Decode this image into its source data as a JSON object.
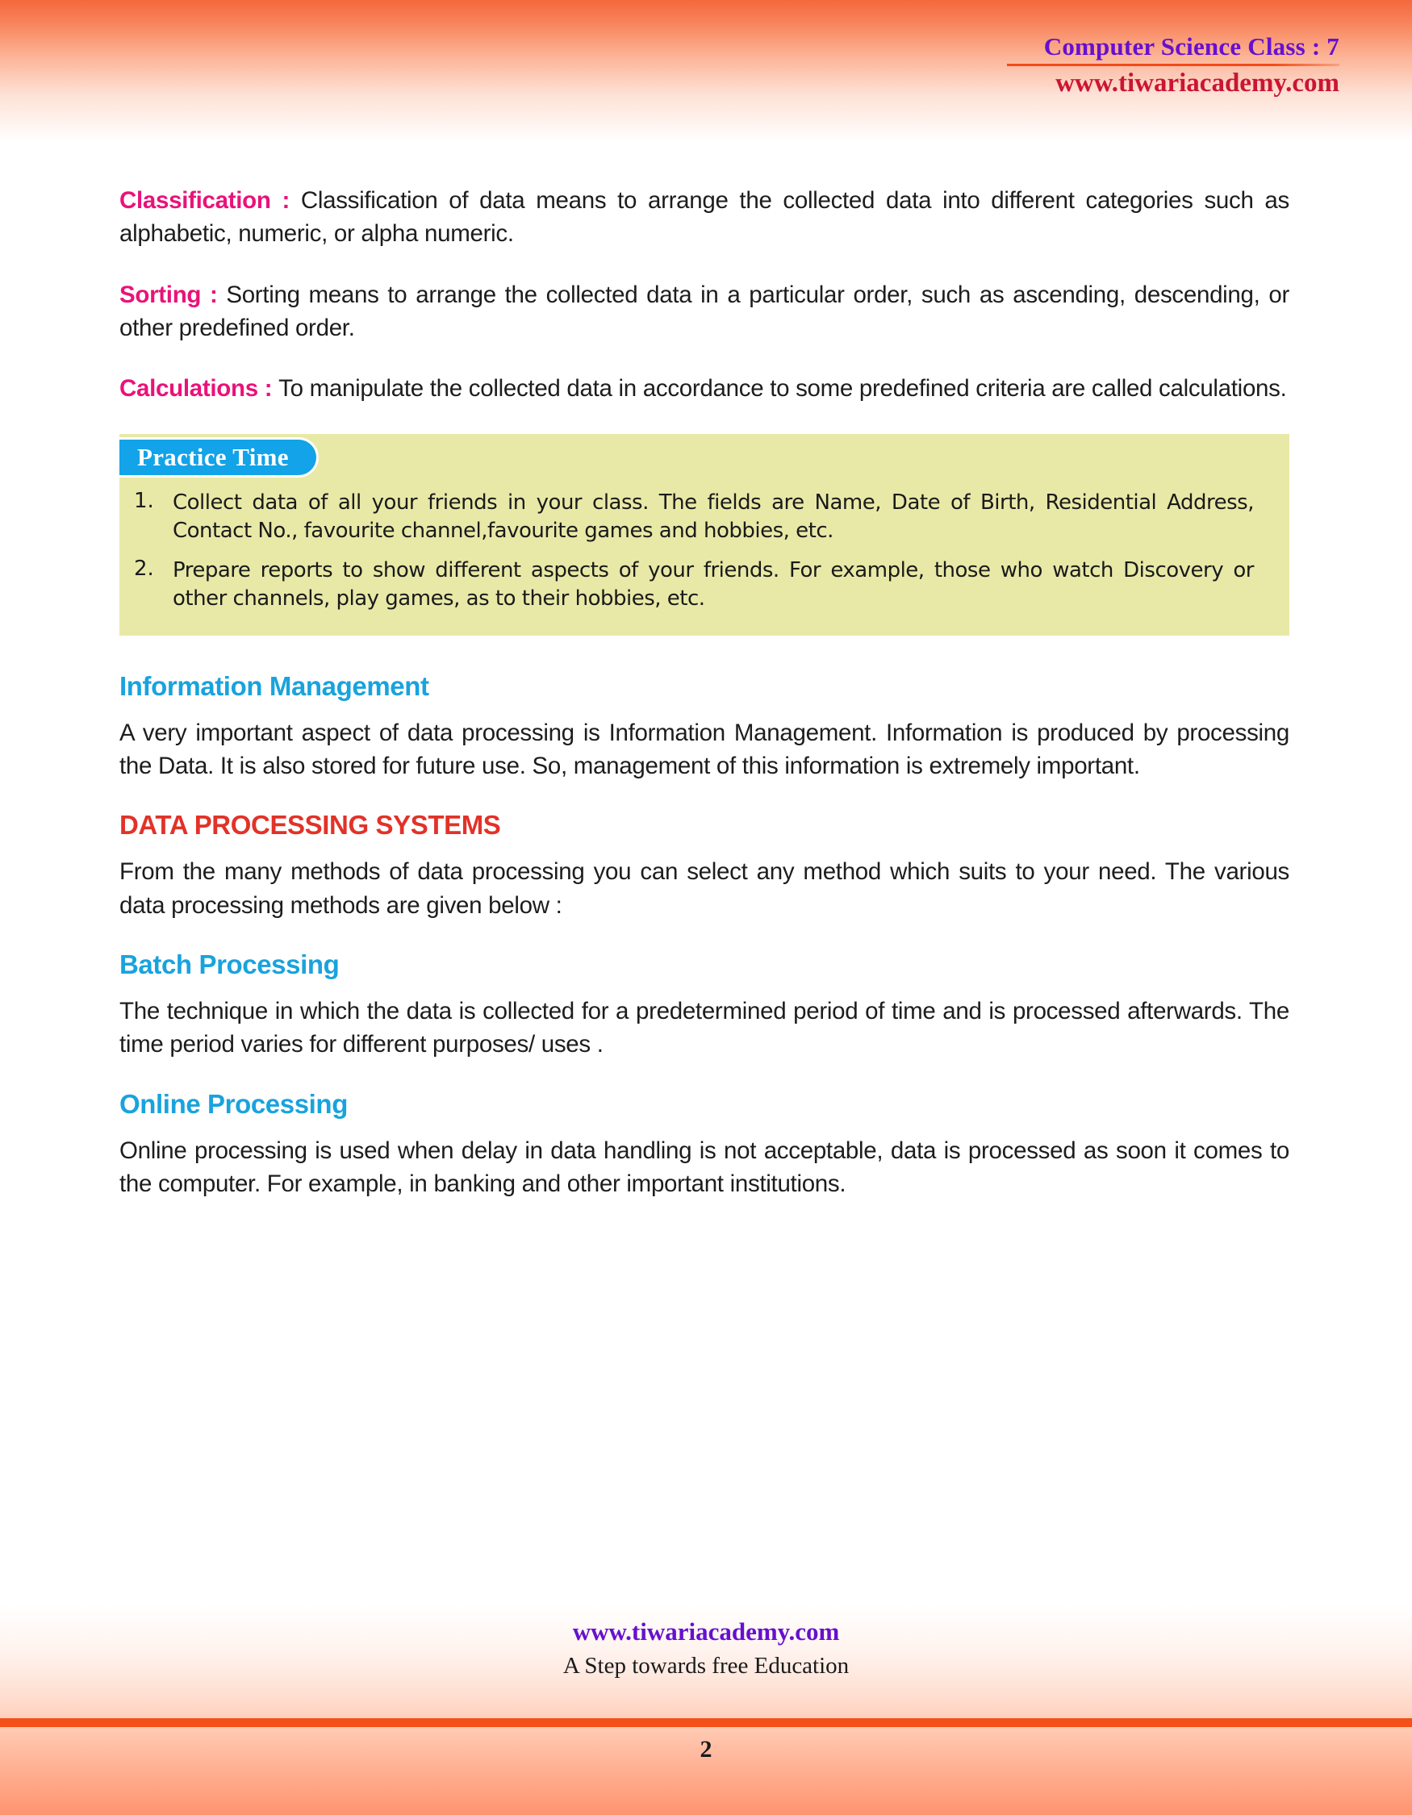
{
  "header": {
    "title": "Computer Science Class : 7",
    "site": "www.tiwariacademy.com"
  },
  "body": {
    "paragraphs": [
      {
        "lead": "Classification : ",
        "text": "Classification of data means to arrange the collected data into different categories such as alphabetic, numeric, or alpha numeric."
      },
      {
        "lead": "Sorting : ",
        "text": "Sorting means to arrange the collected data in a particular order, such as ascending, descending, or other predefined order."
      },
      {
        "lead": "Calculations : ",
        "text": "To manipulate the collected data in accordance to some predefined criteria are called calculations."
      }
    ]
  },
  "practice": {
    "badge": "Practice Time",
    "items": [
      {
        "number": "1.",
        "text": "Collect data of all your friends in your class. The fields are Name, Date of Birth, Residential Address, Contact No., favourite channel,favourite games and hobbies, etc."
      },
      {
        "number": "2.",
        "text": "Prepare reports to show different aspects of your friends. For example, those who watch  Discovery or other channels, play games, as to their hobbies, etc."
      }
    ]
  },
  "sections": [
    {
      "heading": "Information Management",
      "heading_color": "blue",
      "text": "A very important aspect of data processing is Information  Management. Information  is produced by processing the Data. It is also stored for future use. So, management of this information is extremely important."
    },
    {
      "heading": "DATA PROCESSING SYSTEMS",
      "heading_color": "red",
      "text": "From the many methods of data processing you can select any method which suits to your need. The various data processing methods are given below :"
    },
    {
      "heading": "Batch Processing",
      "heading_color": "blue",
      "text": "The technique in which the data is collected for a predetermined period of time and is processed afterwards.  The time period varies for different purposes/ uses ."
    },
    {
      "heading": "Online Processing",
      "heading_color": "blue",
      "text": "Online processing is used when delay in data handling is not acceptable, data is processed as soon it comes to the computer.  For example, in banking and other important institutions."
    }
  ],
  "footer": {
    "site": "www.tiwariacademy.com",
    "tagline": "A Step towards free Education",
    "page_number": "2"
  },
  "colors": {
    "magenta": "#ea1279",
    "blue_heading": "#19a3dd",
    "red_heading": "#e23228",
    "badge_blue": "#12a3e8",
    "practice_bg": "#e8e9a7",
    "header_purple": "#6610cf",
    "header_crimson": "#cc1433",
    "orange_bar": "#f4501a"
  }
}
